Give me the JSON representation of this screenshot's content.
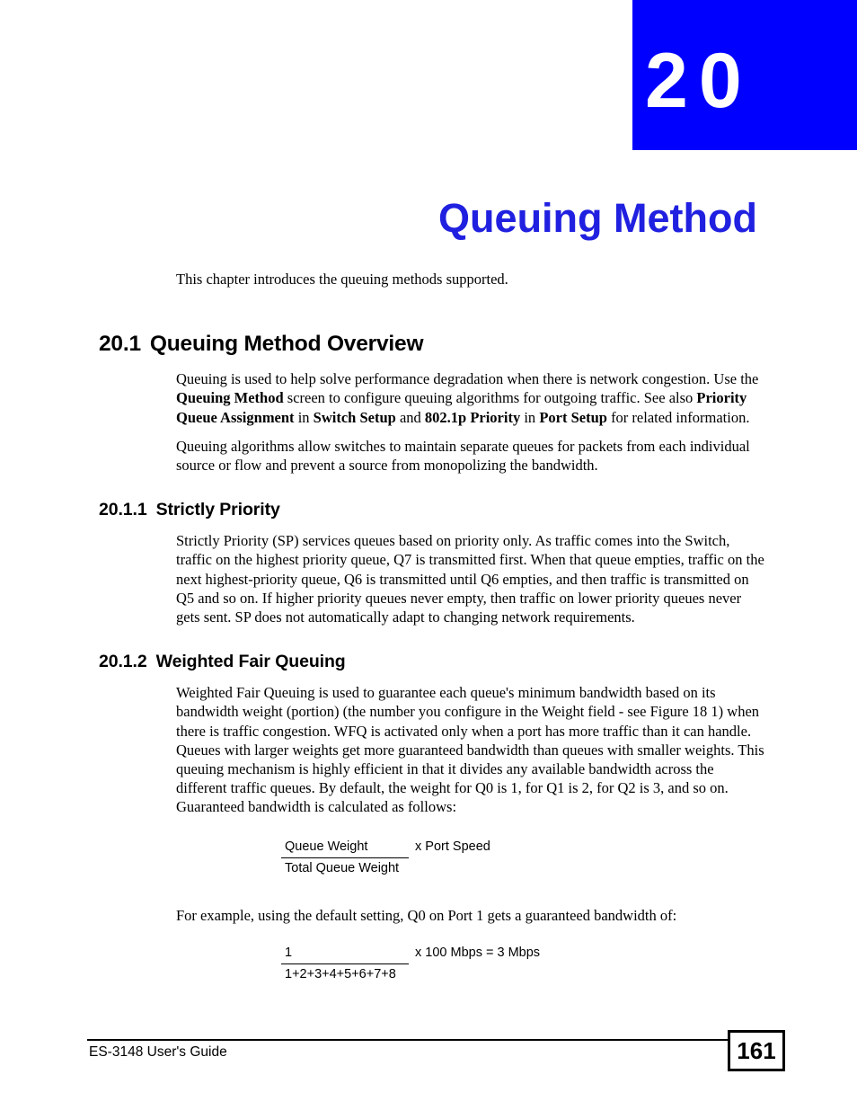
{
  "chapter": {
    "number": "20",
    "title": "Queuing Method",
    "banner_color": "#0000ff",
    "title_color": "#2020e0"
  },
  "intro": {
    "text": "This chapter introduces the queuing methods supported."
  },
  "sections": [
    {
      "number": "20.1",
      "title": "Queuing Method Overview",
      "paragraphs": [
        {
          "p1_a": "Queuing is used to help solve performance degradation when there is network congestion. Use the ",
          "p1_b1": "Queuing Method",
          "p1_b": " screen to configure queuing algorithms for outgoing traffic. See also ",
          "p1_b2": "Priority Queue Assignment",
          "p1_c": " in ",
          "p1_b3": "Switch Setup",
          "p1_d": " and ",
          "p1_b4": "802.1p Priority",
          "p1_e": " in ",
          "p1_b5": "Port Setup",
          "p1_f": " for related information."
        },
        {
          "p2": "Queuing algorithms allow switches to maintain separate queues for packets from each individual source or flow and prevent a source from monopolizing the bandwidth."
        }
      ]
    },
    {
      "number": "20.1.1",
      "title": "Strictly Priority",
      "body": "Strictly Priority (SP) services queues based on priority only. As traffic comes into the Switch, traffic on the highest priority queue, Q7 is transmitted first. When that queue empties, traffic on the next highest-priority queue, Q6 is transmitted until Q6 empties, and then traffic is transmitted on Q5 and so on. If higher priority queues never empty, then traffic on lower priority queues never gets sent. SP does not automatically adapt to changing network requirements."
    },
    {
      "number": "20.1.2",
      "title": "Weighted Fair Queuing",
      "body": "Weighted Fair Queuing is used to guarantee each queue's minimum bandwidth based on its bandwidth weight (portion) (the number you configure in the Weight field - see Figure 18 1) when there is traffic congestion. WFQ is activated only when a port has more traffic than it can handle. Queues with larger weights get more guaranteed bandwidth than queues with smaller weights. This queuing mechanism is highly efficient in that it divides any available bandwidth across the different traffic queues. By default, the weight for Q0 is 1, for Q1 is 2, for Q2 is 3, and so on. Guaranteed bandwidth is calculated as follows:",
      "example_text": "For example, using the default setting, Q0 on Port 1 gets a guaranteed bandwidth of:"
    }
  ],
  "formulas": [
    {
      "numerator": "Queue Weight",
      "denominator": "Total Queue Weight",
      "multiplier": "x Port Speed"
    },
    {
      "numerator": "1",
      "denominator": "1+2+3+4+5+6+7+8",
      "multiplier": "x 100 Mbps = 3 Mbps"
    }
  ],
  "footer": {
    "guide_name": "ES-3148 User's Guide",
    "page_number": "161"
  }
}
